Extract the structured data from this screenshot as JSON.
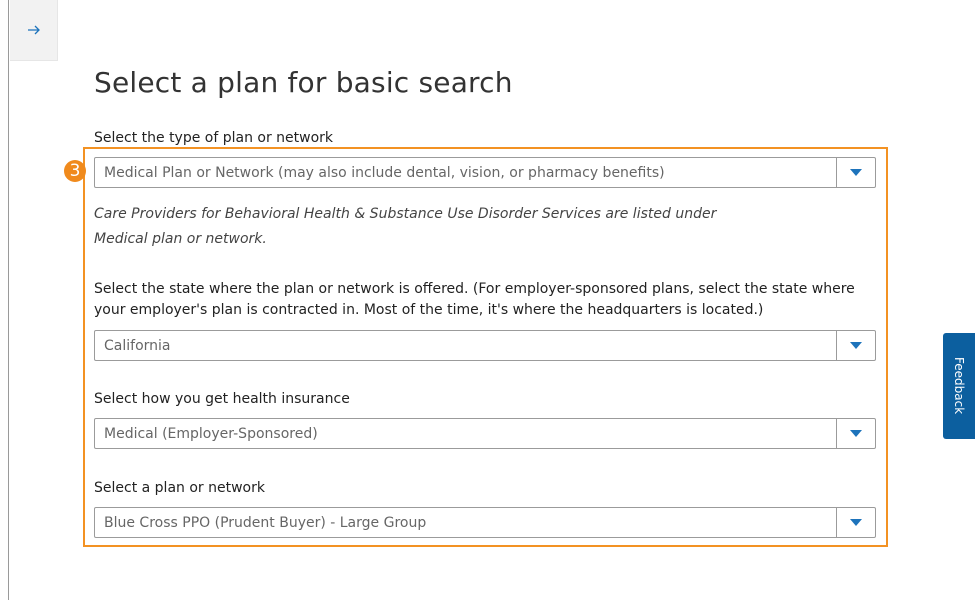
{
  "page": {
    "title": "Select a plan for basic search"
  },
  "plan_type": {
    "label": "Select the type of plan or network",
    "value": "Medical Plan or Network (may also include dental, vision, or pharmacy benefits)",
    "note": "Care Providers for Behavioral Health & Substance Use Disorder Services are listed under Medical plan or network."
  },
  "state": {
    "label": "Select the state where the plan or network is offered. (For employer-sponsored plans, select the state where your employer's plan is contracted in. Most of the time, it's where the headquarters is located.)",
    "value": "California"
  },
  "insurance_source": {
    "label": "Select how you get health insurance",
    "value": "Medical (Employer-Sponsored)"
  },
  "plan": {
    "label": "Select a plan or network",
    "value": "Blue Cross PPO (Prudent Buyer) - Large Group"
  },
  "annotation": {
    "step_number": "3",
    "highlight_color": "#f39223"
  },
  "feedback": {
    "label": "Feedback",
    "color": "#0c5f9f"
  },
  "icons": {
    "back": "arrow-right-icon",
    "dropdown": "caret-down-icon"
  },
  "colors": {
    "caret": "#1d73bb"
  }
}
